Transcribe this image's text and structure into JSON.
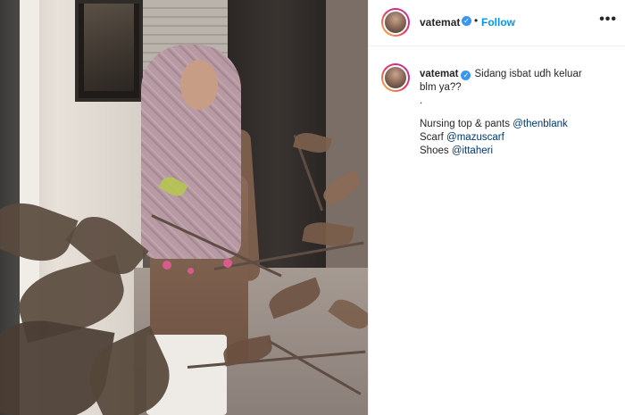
{
  "header": {
    "username": "vatemat",
    "separator": "•",
    "follow_label": "Follow",
    "more_label": "•••",
    "verified_glyph": "✓"
  },
  "caption": {
    "username": "vatemat",
    "text_line1": "Sidang isbat udh keluar",
    "text_line2": "blm ya??",
    "dot_line": ".",
    "credits": [
      {
        "label": "Nursing top & pants",
        "mention": "@thenblank"
      },
      {
        "label": "Scarf",
        "mention": "@mazuscarf"
      },
      {
        "label": "Shoes",
        "mention": "@ittaheri"
      }
    ]
  },
  "colors": {
    "accent": "#0095f6",
    "verified": "#3897f0",
    "mention": "#00376b"
  },
  "icons": [
    "verified-badge-icon",
    "more-options-icon"
  ]
}
